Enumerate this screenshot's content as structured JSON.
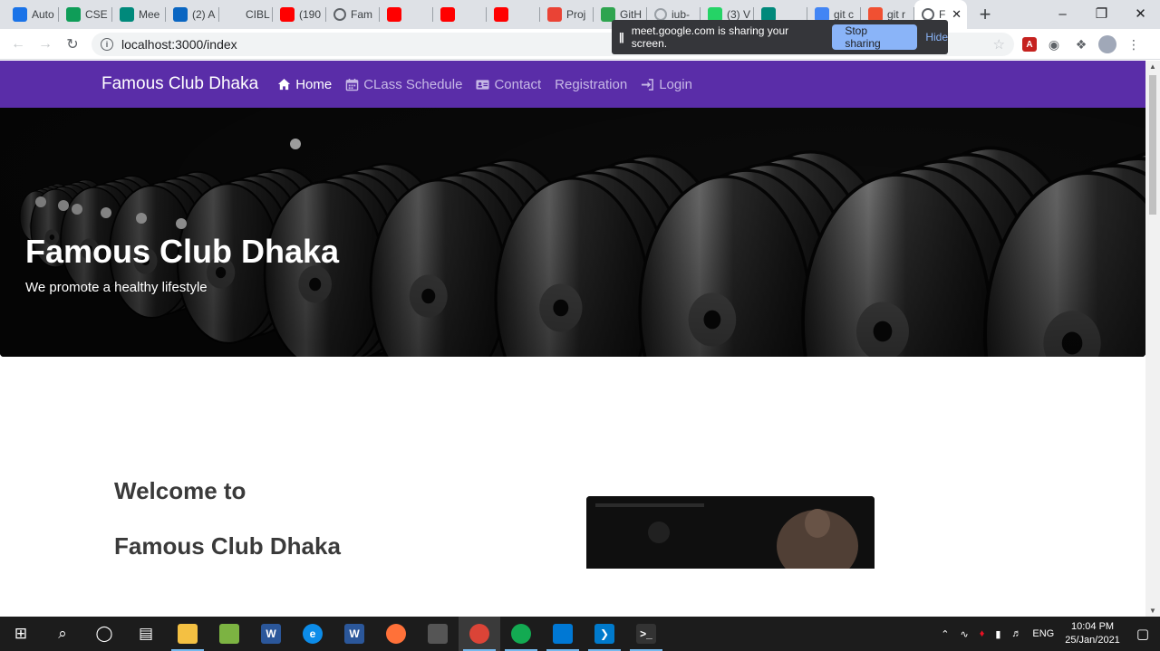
{
  "browser": {
    "tabs": [
      {
        "title": "Auto",
        "icon": "google-account-icon",
        "color": "#1a73e8"
      },
      {
        "title": "CSE",
        "icon": "google-sheets-icon",
        "color": "#0f9d58"
      },
      {
        "title": "Mee",
        "icon": "google-meet-icon",
        "color": "#00897b"
      },
      {
        "title": "(2) A",
        "icon": "linkedin-icon",
        "color": "#0a66c2"
      },
      {
        "title": "CIBL",
        "icon": "blank-page-icon",
        "color": "#dee1e6"
      },
      {
        "title": "(190",
        "icon": "youtube-icon",
        "color": "#ff0000"
      },
      {
        "title": "Fam",
        "icon": "globe-icon",
        "color": "#5f6368"
      },
      {
        "title": "",
        "icon": "youtube-icon",
        "color": "#ff0000"
      },
      {
        "title": "",
        "icon": "youtube-icon",
        "color": "#ff0000"
      },
      {
        "title": "",
        "icon": "youtube-icon",
        "color": "#ff0000"
      },
      {
        "title": "Proj",
        "icon": "gmail-icon",
        "color": "#ea4335"
      },
      {
        "title": "GitH",
        "icon": "github-icon",
        "color": "#2ea44f"
      },
      {
        "title": "iub-",
        "icon": "loading-icon",
        "color": "#9aa0a6"
      },
      {
        "title": "(3) V",
        "icon": "whatsapp-icon",
        "color": "#25d366"
      },
      {
        "title": "",
        "icon": "google-meet-icon",
        "color": "#00897b"
      },
      {
        "title": "git c",
        "icon": "google-icon",
        "color": "#4285f4"
      },
      {
        "title": "git r",
        "icon": "git-icon",
        "color": "#f05032"
      },
      {
        "title": "F",
        "icon": "globe-icon",
        "color": "#5f6368",
        "active": true
      }
    ],
    "url": "localhost:3000/index",
    "share_banner": {
      "message": "meet.google.com is sharing your screen.",
      "stop_label": "Stop sharing",
      "hide_label": "Hide"
    }
  },
  "site": {
    "brand": "Famous Club Dhaka",
    "nav": [
      {
        "label": "Home",
        "icon": "home-icon",
        "active": true
      },
      {
        "label": "CLass Schedule",
        "icon": "calendar-icon",
        "active": false
      },
      {
        "label": "Contact",
        "icon": "address-card-icon",
        "active": false
      },
      {
        "label": "Registration",
        "icon": "",
        "active": false
      },
      {
        "label": "Login",
        "icon": "sign-in-icon",
        "active": false
      }
    ],
    "hero": {
      "title": "Famous Club Dhaka",
      "subtitle": "We promote a healthy lifestyle"
    },
    "welcome": {
      "line1": "Welcome to",
      "line2": "Famous Club Dhaka"
    },
    "colors": {
      "navbar": "#5a2da8",
      "nav_inactive": "#c6b8e6"
    }
  },
  "taskbar": {
    "apps": [
      "start-icon",
      "search-icon",
      "cortana-icon",
      "task-view-icon",
      "file-explorer-icon",
      "notepad-icon",
      "word-icon",
      "edge-icon",
      "word-icon",
      "firefox-icon",
      "app-icon",
      "chrome-icon",
      "mongodb-compass-icon",
      "remote-desktop-icon",
      "vscode-icon",
      "terminal-icon"
    ],
    "language": "ENG",
    "time": "10:04 PM",
    "date": "25/Jan/2021"
  }
}
